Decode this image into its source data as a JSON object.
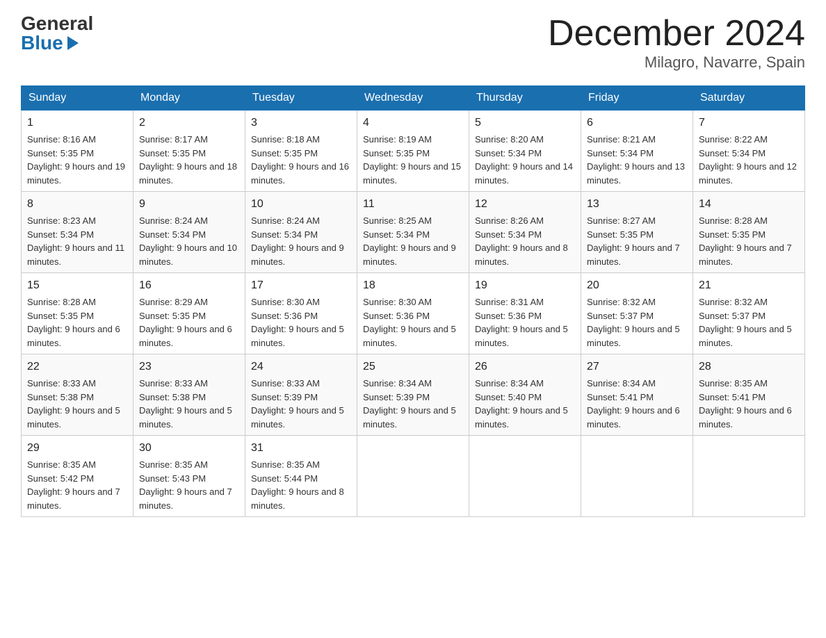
{
  "header": {
    "logo_general": "General",
    "logo_blue": "Blue",
    "month_title": "December 2024",
    "location": "Milagro, Navarre, Spain"
  },
  "days_of_week": [
    "Sunday",
    "Monday",
    "Tuesday",
    "Wednesday",
    "Thursday",
    "Friday",
    "Saturday"
  ],
  "weeks": [
    [
      {
        "day": "1",
        "sunrise": "8:16 AM",
        "sunset": "5:35 PM",
        "daylight": "9 hours and 19 minutes."
      },
      {
        "day": "2",
        "sunrise": "8:17 AM",
        "sunset": "5:35 PM",
        "daylight": "9 hours and 18 minutes."
      },
      {
        "day": "3",
        "sunrise": "8:18 AM",
        "sunset": "5:35 PM",
        "daylight": "9 hours and 16 minutes."
      },
      {
        "day": "4",
        "sunrise": "8:19 AM",
        "sunset": "5:35 PM",
        "daylight": "9 hours and 15 minutes."
      },
      {
        "day": "5",
        "sunrise": "8:20 AM",
        "sunset": "5:34 PM",
        "daylight": "9 hours and 14 minutes."
      },
      {
        "day": "6",
        "sunrise": "8:21 AM",
        "sunset": "5:34 PM",
        "daylight": "9 hours and 13 minutes."
      },
      {
        "day": "7",
        "sunrise": "8:22 AM",
        "sunset": "5:34 PM",
        "daylight": "9 hours and 12 minutes."
      }
    ],
    [
      {
        "day": "8",
        "sunrise": "8:23 AM",
        "sunset": "5:34 PM",
        "daylight": "9 hours and 11 minutes."
      },
      {
        "day": "9",
        "sunrise": "8:24 AM",
        "sunset": "5:34 PM",
        "daylight": "9 hours and 10 minutes."
      },
      {
        "day": "10",
        "sunrise": "8:24 AM",
        "sunset": "5:34 PM",
        "daylight": "9 hours and 9 minutes."
      },
      {
        "day": "11",
        "sunrise": "8:25 AM",
        "sunset": "5:34 PM",
        "daylight": "9 hours and 9 minutes."
      },
      {
        "day": "12",
        "sunrise": "8:26 AM",
        "sunset": "5:34 PM",
        "daylight": "9 hours and 8 minutes."
      },
      {
        "day": "13",
        "sunrise": "8:27 AM",
        "sunset": "5:35 PM",
        "daylight": "9 hours and 7 minutes."
      },
      {
        "day": "14",
        "sunrise": "8:28 AM",
        "sunset": "5:35 PM",
        "daylight": "9 hours and 7 minutes."
      }
    ],
    [
      {
        "day": "15",
        "sunrise": "8:28 AM",
        "sunset": "5:35 PM",
        "daylight": "9 hours and 6 minutes."
      },
      {
        "day": "16",
        "sunrise": "8:29 AM",
        "sunset": "5:35 PM",
        "daylight": "9 hours and 6 minutes."
      },
      {
        "day": "17",
        "sunrise": "8:30 AM",
        "sunset": "5:36 PM",
        "daylight": "9 hours and 5 minutes."
      },
      {
        "day": "18",
        "sunrise": "8:30 AM",
        "sunset": "5:36 PM",
        "daylight": "9 hours and 5 minutes."
      },
      {
        "day": "19",
        "sunrise": "8:31 AM",
        "sunset": "5:36 PM",
        "daylight": "9 hours and 5 minutes."
      },
      {
        "day": "20",
        "sunrise": "8:32 AM",
        "sunset": "5:37 PM",
        "daylight": "9 hours and 5 minutes."
      },
      {
        "day": "21",
        "sunrise": "8:32 AM",
        "sunset": "5:37 PM",
        "daylight": "9 hours and 5 minutes."
      }
    ],
    [
      {
        "day": "22",
        "sunrise": "8:33 AM",
        "sunset": "5:38 PM",
        "daylight": "9 hours and 5 minutes."
      },
      {
        "day": "23",
        "sunrise": "8:33 AM",
        "sunset": "5:38 PM",
        "daylight": "9 hours and 5 minutes."
      },
      {
        "day": "24",
        "sunrise": "8:33 AM",
        "sunset": "5:39 PM",
        "daylight": "9 hours and 5 minutes."
      },
      {
        "day": "25",
        "sunrise": "8:34 AM",
        "sunset": "5:39 PM",
        "daylight": "9 hours and 5 minutes."
      },
      {
        "day": "26",
        "sunrise": "8:34 AM",
        "sunset": "5:40 PM",
        "daylight": "9 hours and 5 minutes."
      },
      {
        "day": "27",
        "sunrise": "8:34 AM",
        "sunset": "5:41 PM",
        "daylight": "9 hours and 6 minutes."
      },
      {
        "day": "28",
        "sunrise": "8:35 AM",
        "sunset": "5:41 PM",
        "daylight": "9 hours and 6 minutes."
      }
    ],
    [
      {
        "day": "29",
        "sunrise": "8:35 AM",
        "sunset": "5:42 PM",
        "daylight": "9 hours and 7 minutes."
      },
      {
        "day": "30",
        "sunrise": "8:35 AM",
        "sunset": "5:43 PM",
        "daylight": "9 hours and 7 minutes."
      },
      {
        "day": "31",
        "sunrise": "8:35 AM",
        "sunset": "5:44 PM",
        "daylight": "9 hours and 8 minutes."
      },
      null,
      null,
      null,
      null
    ]
  ]
}
